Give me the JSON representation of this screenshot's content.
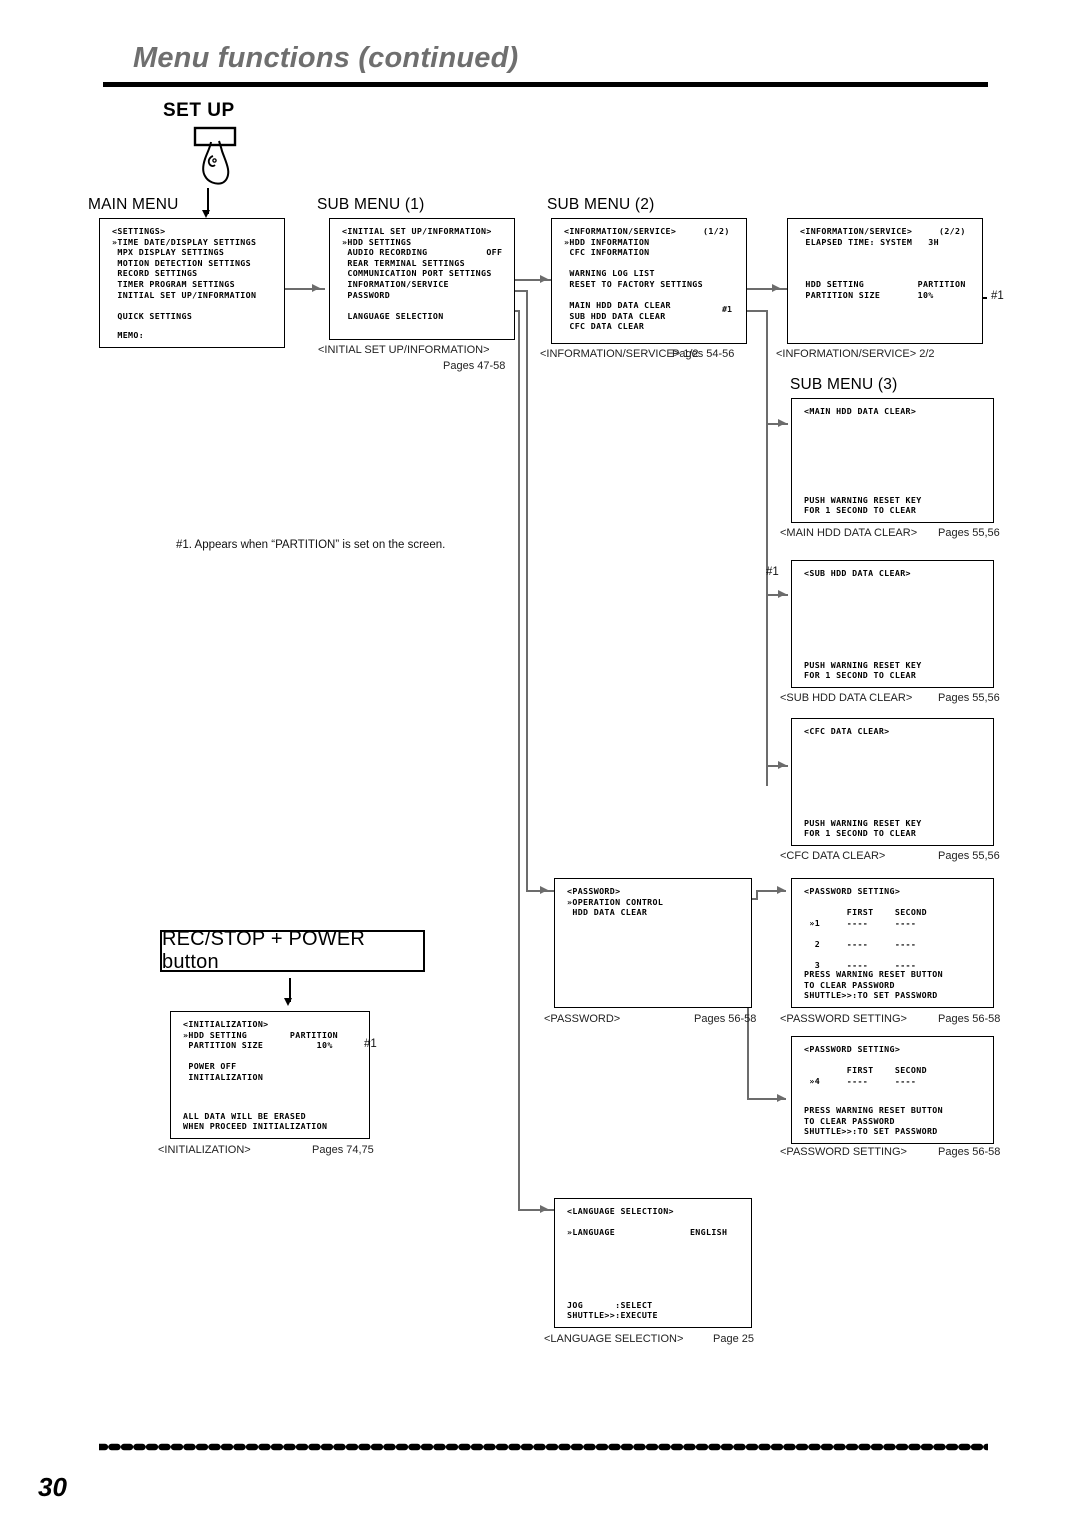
{
  "header": {
    "title": "Menu functions (continued)"
  },
  "setup": {
    "label": "SET UP",
    "icon": "finger-press-button-icon"
  },
  "columns": {
    "main_menu": "MAIN MENU",
    "sub_menu_1": "SUB MENU (1)",
    "sub_menu_2": "SUB MENU (2)",
    "sub_menu_3": "SUB MENU (3)"
  },
  "screens": {
    "settings": {
      "lines": [
        "<SETTINGS>",
        "»TIME DATE/DISPLAY SETTINGS",
        " MPX DISPLAY SETTINGS",
        " MOTION DETECTION SETTINGS",
        " RECORD SETTINGS",
        " TIMER PROGRAM SETTINGS",
        " INITIAL SET UP/INFORMATION",
        "",
        " QUICK SETTINGS"
      ],
      "footer": [
        " MEMO:"
      ]
    },
    "initial_setup": {
      "lines": [
        "<INITIAL SET UP/INFORMATION>",
        "»HDD SETTINGS",
        " AUDIO RECORDING           OFF",
        " REAR TERMINAL SETTINGS",
        " COMMUNICATION PORT SETTINGS",
        " INFORMATION/SERVICE",
        " PASSWORD",
        "",
        " LANGUAGE SELECTION"
      ],
      "caption": "<INITIAL SET UP/INFORMATION>",
      "pages": "Pages 47-58"
    },
    "info_service_1": {
      "lines": [
        "<INFORMATION/SERVICE>     (1/2)",
        "»HDD INFORMATION",
        " CFC INFORMATION",
        "",
        " WARNING LOG LIST",
        " RESET TO FACTORY SETTINGS",
        "",
        " MAIN HDD DATA CLEAR",
        " SUB HDD DATA CLEAR",
        " CFC DATA CLEAR"
      ],
      "caption": "<INFORMATION/SERVICE> 1/2",
      "pages": "Pages 54-56",
      "hash_marker": "#1"
    },
    "info_service_2": {
      "lines": [
        "<INFORMATION/SERVICE>     (2/2)",
        " ELAPSED TIME: SYSTEM   3H",
        "",
        "",
        "",
        " HDD SETTING          PARTITION",
        " PARTITION SIZE       10%"
      ],
      "caption": "<INFORMATION/SERVICE> 2/2",
      "hash_marker": "#1"
    },
    "main_hdd_data_clear": {
      "lines": [
        "<MAIN HDD DATA CLEAR>"
      ],
      "footer": [
        "PUSH WARNING RESET KEY",
        "FOR 1 SECOND TO CLEAR"
      ],
      "caption": "<MAIN HDD DATA CLEAR>",
      "pages": "Pages 55,56"
    },
    "sub_hdd_data_clear": {
      "lines": [
        "<SUB HDD DATA CLEAR>"
      ],
      "footer": [
        "PUSH WARNING RESET KEY",
        "FOR 1 SECOND TO CLEAR"
      ],
      "caption": "<SUB HDD DATA CLEAR>",
      "pages": "Pages 55,56",
      "hash_marker": "#1"
    },
    "cfc_data_clear": {
      "lines": [
        "<CFC DATA CLEAR>"
      ],
      "footer": [
        "PUSH WARNING RESET KEY",
        "FOR 1 SECOND TO CLEAR"
      ],
      "caption": "<CFC DATA CLEAR>",
      "pages": "Pages 55,56"
    },
    "password": {
      "lines": [
        "<PASSWORD>",
        "»OPERATION CONTROL",
        " HDD DATA CLEAR"
      ],
      "caption": "<PASSWORD>",
      "pages": "Pages 56-58"
    },
    "password_setting_123": {
      "lines": [
        "<PASSWORD SETTING>",
        "",
        "        FIRST    SECOND",
        " »1     ----     ----",
        "",
        "  2     ----     ----",
        "",
        "  3     ----     ----"
      ],
      "footer": [
        "PRESS WARNING RESET BUTTON",
        "TO CLEAR PASSWORD",
        "SHUTTLE>>:TO SET PASSWORD"
      ],
      "caption": "<PASSWORD SETTING>",
      "pages": "Pages 56-58"
    },
    "password_setting_4": {
      "lines": [
        "<PASSWORD SETTING>",
        "",
        "        FIRST    SECOND",
        " »4     ----     ----"
      ],
      "footer": [
        "PRESS WARNING RESET BUTTON",
        "TO CLEAR PASSWORD",
        "SHUTTLE>>:TO SET PASSWORD"
      ],
      "caption": "<PASSWORD SETTING>",
      "pages": "Pages 56-58"
    },
    "initialization": {
      "lines": [
        "<INITIALIZATION>",
        "»HDD SETTING        PARTITION",
        " PARTITION SIZE          10%",
        "",
        " POWER OFF",
        " INITIALIZATION"
      ],
      "footer": [
        "ALL DATA WILL BE ERASED",
        "WHEN PROCEED INITIALIZATION"
      ],
      "caption": "<INITIALIZATION>",
      "pages": "Pages 74,75",
      "hash_marker": "#1"
    },
    "language_selection": {
      "lines": [
        "<LANGUAGE SELECTION>",
        "",
        "»LANGUAGE              ENGLISH"
      ],
      "footer": [
        "JOG      :SELECT",
        "SHUTTLE>>:EXECUTE"
      ],
      "caption": "<LANGUAGE SELECTION>",
      "pages": "Page 25"
    }
  },
  "rec_stop_button": {
    "label": "REC/STOP + POWER button"
  },
  "footnote": {
    "text": "#1. Appears when “PARTITION” is set on the screen."
  },
  "footer": {
    "page_number": "30"
  },
  "colors": {
    "title_gray": "#6f6f6f",
    "line_gray": "#6c6c6c",
    "ink": "#000000"
  }
}
